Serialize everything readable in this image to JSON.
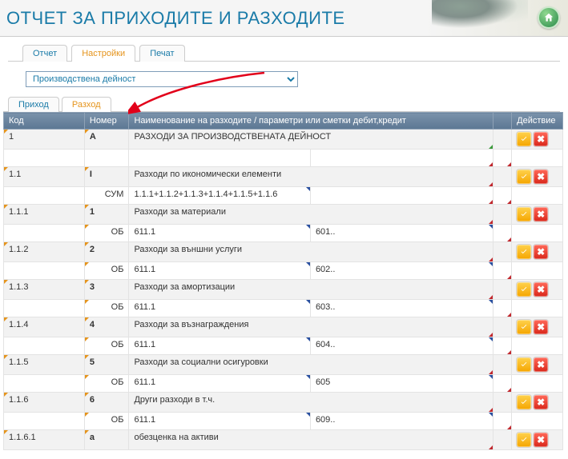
{
  "header": {
    "title": "ОТЧЕТ ЗА ПРИХОДИТЕ И РАЗХОДИТЕ"
  },
  "tabs": {
    "report": "Отчет",
    "settings": "Настройки",
    "print": "Печат",
    "active": "settings"
  },
  "dropdown": {
    "value": "Производствена дейност"
  },
  "subtabs": {
    "income": "Приход",
    "expense": "Разход",
    "active": "expense"
  },
  "grid": {
    "headers": {
      "code": "Код",
      "num": "Номер",
      "name": "Наименование на разходите / параметри или сметки дебит,кредит",
      "action": "Действие"
    },
    "rows": [
      {
        "code": "1",
        "num": "А",
        "name": "РАЗХОДИ ЗА ПРОИЗВОДСТВЕНАТА ДЕЙНОСТ",
        "actions": true,
        "sub": {
          "num": "",
          "p1": "",
          "p2": ""
        }
      },
      {
        "code": "1.1",
        "num": "I",
        "name": "Разходи по икономически елементи",
        "actions": true,
        "sub": {
          "num": "СУМ",
          "p1": "1.1.1+1.1.2+1.1.3+1.1.4+1.1.5+1.1.6",
          "p2": ""
        }
      },
      {
        "code": "1.1.1",
        "num": "1",
        "name": "Разходи за материали",
        "actions": true,
        "sub": {
          "num": "ОБ",
          "p1": "611.1",
          "p2": "601.."
        }
      },
      {
        "code": "1.1.2",
        "num": "2",
        "name": "Разходи за външни услуги",
        "actions": true,
        "sub": {
          "num": "ОБ",
          "p1": "611.1",
          "p2": "602.."
        }
      },
      {
        "code": "1.1.3",
        "num": "3",
        "name": "Разходи за амортизации",
        "actions": true,
        "sub": {
          "num": "ОБ",
          "p1": "611.1",
          "p2": "603.."
        }
      },
      {
        "code": "1.1.4",
        "num": "4",
        "name": "Разходи за възнаграждения",
        "actions": true,
        "sub": {
          "num": "ОБ",
          "p1": "611.1",
          "p2": "604.."
        }
      },
      {
        "code": "1.1.5",
        "num": "5",
        "name": "Разходи за социални осигуровки",
        "actions": true,
        "sub": {
          "num": "ОБ",
          "p1": "611.1",
          "p2": "605"
        }
      },
      {
        "code": "1.1.6",
        "num": "6",
        "name": "Други разходи в т.ч.",
        "actions": true,
        "sub": {
          "num": "ОБ",
          "p1": "611.1",
          "p2": "609.."
        }
      },
      {
        "code": "1.1.6.1",
        "num": "а",
        "name": "обезценка на активи",
        "actions": true,
        "sub": null
      }
    ]
  }
}
